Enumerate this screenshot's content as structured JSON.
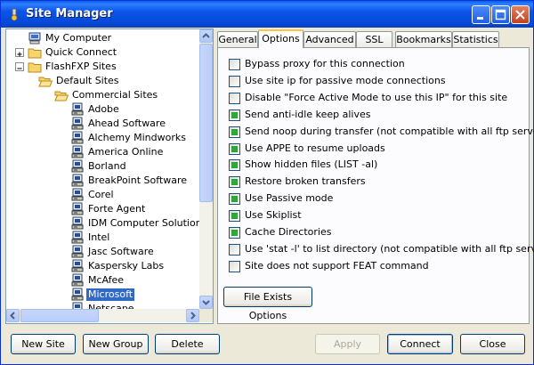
{
  "window": {
    "title": "Site Manager"
  },
  "tree": {
    "items": [
      {
        "label": "My Computer",
        "icon": "computer-icon"
      },
      {
        "label": "Quick Connect",
        "icon": "folder-icon"
      },
      {
        "label": "FlashFXP Sites",
        "icon": "folder-icon"
      },
      {
        "label": "Default Sites",
        "icon": "folder-open-icon"
      },
      {
        "label": "Commercial Sites",
        "icon": "folder-open-icon"
      },
      {
        "label": "Adobe",
        "icon": "server-icon"
      },
      {
        "label": "Ahead Software",
        "icon": "server-icon"
      },
      {
        "label": "Alchemy Mindworks",
        "icon": "server-icon"
      },
      {
        "label": "America Online",
        "icon": "server-icon"
      },
      {
        "label": "Borland",
        "icon": "server-icon"
      },
      {
        "label": "BreakPoint Software",
        "icon": "server-icon"
      },
      {
        "label": "Corel",
        "icon": "server-icon"
      },
      {
        "label": "Forte Agent",
        "icon": "server-icon"
      },
      {
        "label": "IDM Computer Solutions",
        "icon": "server-icon"
      },
      {
        "label": "Intel",
        "icon": "server-icon"
      },
      {
        "label": "Jasc Software",
        "icon": "server-icon"
      },
      {
        "label": "Kaspersky Labs",
        "icon": "server-icon"
      },
      {
        "label": "McAfee",
        "icon": "server-icon"
      },
      {
        "label": "Microsoft",
        "icon": "server-icon",
        "selected": true
      },
      {
        "label": "Netscape",
        "icon": "server-icon"
      }
    ]
  },
  "tabs": [
    {
      "label": "General"
    },
    {
      "label": "Options",
      "active": true
    },
    {
      "label": "Advanced"
    },
    {
      "label": "SSL"
    },
    {
      "label": "Bookmarks"
    },
    {
      "label": "Statistics"
    }
  ],
  "options": [
    {
      "label": "Bypass proxy for this connection",
      "checked": false
    },
    {
      "label": "Use site ip for passive mode connections",
      "checked": false
    },
    {
      "label": "Disable \"Force Active Mode to use this IP\" for this site",
      "checked": false
    },
    {
      "label": "Send anti-idle keep alives",
      "checked": true
    },
    {
      "label": "Send noop during transfer  (not compatible with all ftp servers)",
      "checked": true
    },
    {
      "label": "Use APPE to resume uploads",
      "checked": true
    },
    {
      "label": "Show hidden files (LIST -al)",
      "checked": true
    },
    {
      "label": "Restore broken transfers",
      "checked": true
    },
    {
      "label": "Use Passive mode",
      "checked": true
    },
    {
      "label": "Use Skiplist",
      "checked": true
    },
    {
      "label": "Cache Directories",
      "checked": true
    },
    {
      "label": "Use 'stat -l' to list directory  (not compatible with all ftp servers)",
      "checked": false
    },
    {
      "label": "Site does not support FEAT command",
      "checked": false
    }
  ],
  "buttons": {
    "file_exists": "File Exists Options",
    "new_site": "New Site",
    "new_group": "New Group",
    "delete": "Delete",
    "apply": "Apply",
    "connect": "Connect",
    "close": "Close"
  }
}
